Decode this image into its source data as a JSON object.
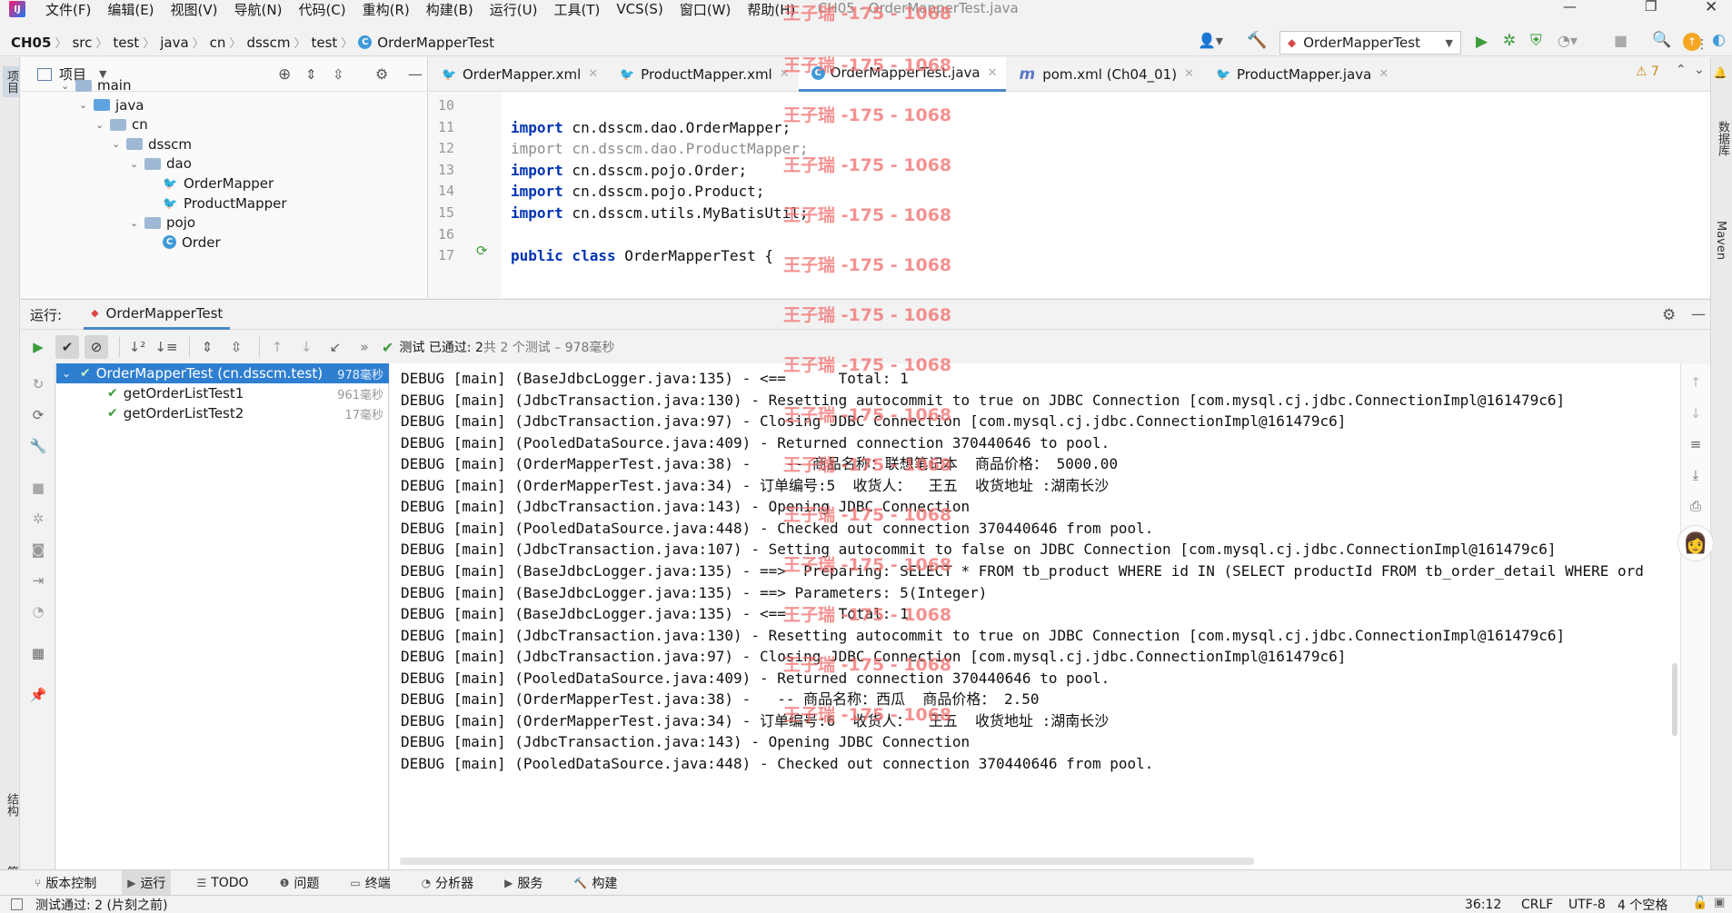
{
  "window": {
    "title": "CH05 - OrderMapperTest.java"
  },
  "menu": [
    "文件(F)",
    "编辑(E)",
    "视图(V)",
    "导航(N)",
    "代码(C)",
    "重构(R)",
    "构建(B)",
    "运行(U)",
    "工具(T)",
    "VCS(S)",
    "窗口(W)",
    "帮助(H)"
  ],
  "breadcrumb": [
    "CH05",
    "src",
    "test",
    "java",
    "cn",
    "dsscm",
    "test",
    "OrderMapperTest"
  ],
  "run_config": "OrderMapperTest",
  "project_panel": {
    "title": "项目",
    "tree": [
      {
        "label": "main",
        "depth": 0,
        "kind": "folder"
      },
      {
        "label": "java",
        "depth": 1,
        "kind": "folder-blue"
      },
      {
        "label": "cn",
        "depth": 2,
        "kind": "folder"
      },
      {
        "label": "dsscm",
        "depth": 3,
        "kind": "folder"
      },
      {
        "label": "dao",
        "depth": 4,
        "kind": "folder"
      },
      {
        "label": "OrderMapper",
        "depth": 5,
        "kind": "mybatis"
      },
      {
        "label": "ProductMapper",
        "depth": 5,
        "kind": "mybatis"
      },
      {
        "label": "pojo",
        "depth": 4,
        "kind": "folder"
      },
      {
        "label": "Order",
        "depth": 5,
        "kind": "class"
      }
    ]
  },
  "left_stripe": {
    "top": "项目",
    "structure": "结构",
    "bookmarks": "书签"
  },
  "right_stripe": {
    "db": "数据库",
    "maven": "Maven"
  },
  "editor": {
    "tabs": [
      "OrderMapper.xml",
      "ProductMapper.xml",
      "OrderMapperTest.java",
      "pom.xml (Ch04_01)",
      "ProductMapper.java"
    ],
    "warnings": "7",
    "lines": [
      {
        "n": "10",
        "code": ""
      },
      {
        "n": "11",
        "kw": "import",
        "rest": " cn.dsscm.dao.OrderMapper;"
      },
      {
        "n": "12",
        "kw": "import",
        "rest": " cn.dsscm.dao.ProductMapper;",
        "dim": true
      },
      {
        "n": "13",
        "kw": "import",
        "rest": " cn.dsscm.pojo.Order;"
      },
      {
        "n": "14",
        "kw": "import",
        "rest": " cn.dsscm.pojo.Product;"
      },
      {
        "n": "15",
        "kw": "import",
        "rest": " cn.dsscm.utils.MyBatisUtil;"
      },
      {
        "n": "16",
        "code": ""
      },
      {
        "n": "17",
        "kw": "public class",
        "rest": " OrderMapperTest {"
      }
    ]
  },
  "run": {
    "label": "运行:",
    "tab": "OrderMapperTest",
    "status": "测试 已通过: 2",
    "status_detail": "共 2 个测试 – 978毫秒",
    "tests": [
      {
        "name": "OrderMapperTest (cn.dsscm.test)",
        "time": "978毫秒",
        "root": true
      },
      {
        "name": "getOrderListTest1",
        "time": "961毫秒"
      },
      {
        "name": "getOrderListTest2",
        "time": "17毫秒"
      }
    ],
    "console": [
      "DEBUG [main] (BaseJdbcLogger.java:135) - <==      Total: 1",
      "DEBUG [main] (JdbcTransaction.java:130) - Resetting autocommit to true on JDBC Connection [com.mysql.cj.jdbc.ConnectionImpl@161479c6]",
      "DEBUG [main] (JdbcTransaction.java:97) - Closing JDBC Connection [com.mysql.cj.jdbc.ConnectionImpl@161479c6]",
      "DEBUG [main] (PooledDataSource.java:409) - Returned connection 370440646 to pool.",
      "DEBUG [main] (OrderMapperTest.java:38) -    -- 商品名称：联想笔记本  商品价格： 5000.00",
      "DEBUG [main] (OrderMapperTest.java:34) - 订单编号:5  收货人：  王五  收货地址 :湖南长沙",
      "DEBUG [main] (JdbcTransaction.java:143) - Opening JDBC Connection",
      "DEBUG [main] (PooledDataSource.java:448) - Checked out connection 370440646 from pool.",
      "DEBUG [main] (JdbcTransaction.java:107) - Setting autocommit to false on JDBC Connection [com.mysql.cj.jdbc.ConnectionImpl@161479c6]",
      "DEBUG [main] (BaseJdbcLogger.java:135) - ==>  Preparing: SELECT * FROM tb_product WHERE id IN (SELECT productId FROM tb_order_detail WHERE ord",
      "DEBUG [main] (BaseJdbcLogger.java:135) - ==> Parameters: 5(Integer)",
      "DEBUG [main] (BaseJdbcLogger.java:135) - <==      Total: 1",
      "DEBUG [main] (JdbcTransaction.java:130) - Resetting autocommit to true on JDBC Connection [com.mysql.cj.jdbc.ConnectionImpl@161479c6]",
      "DEBUG [main] (JdbcTransaction.java:97) - Closing JDBC Connection [com.mysql.cj.jdbc.ConnectionImpl@161479c6]",
      "DEBUG [main] (PooledDataSource.java:409) - Returned connection 370440646 to pool.",
      "DEBUG [main] (OrderMapperTest.java:38) -   -- 商品名称：西瓜  商品价格： 2.50",
      "DEBUG [main] (OrderMapperTest.java:34) - 订单编号:6  收货人：  王五  收货地址 :湖南长沙",
      "DEBUG [main] (JdbcTransaction.java:143) - Opening JDBC Connection",
      "DEBUG [main] (PooledDataSource.java:448) - Checked out connection 370440646 from pool."
    ]
  },
  "bottom_tools": [
    "版本控制",
    "运行",
    "TODO",
    "问题",
    "终端",
    "分析器",
    "服务",
    "构建"
  ],
  "status_bar": {
    "message": "测试通过: 2 (片刻之前)",
    "position": "36:12",
    "line_sep": "CRLF",
    "encoding": "UTF-8",
    "indent": "4 个空格"
  },
  "watermark": "王子瑞 -175 - 1068",
  "colors": {
    "accent": "#4a88c7",
    "pass": "#3d9c3d",
    "run": "#4caf50",
    "keyword": "#0033b3",
    "watermark": "#f26d6d"
  }
}
